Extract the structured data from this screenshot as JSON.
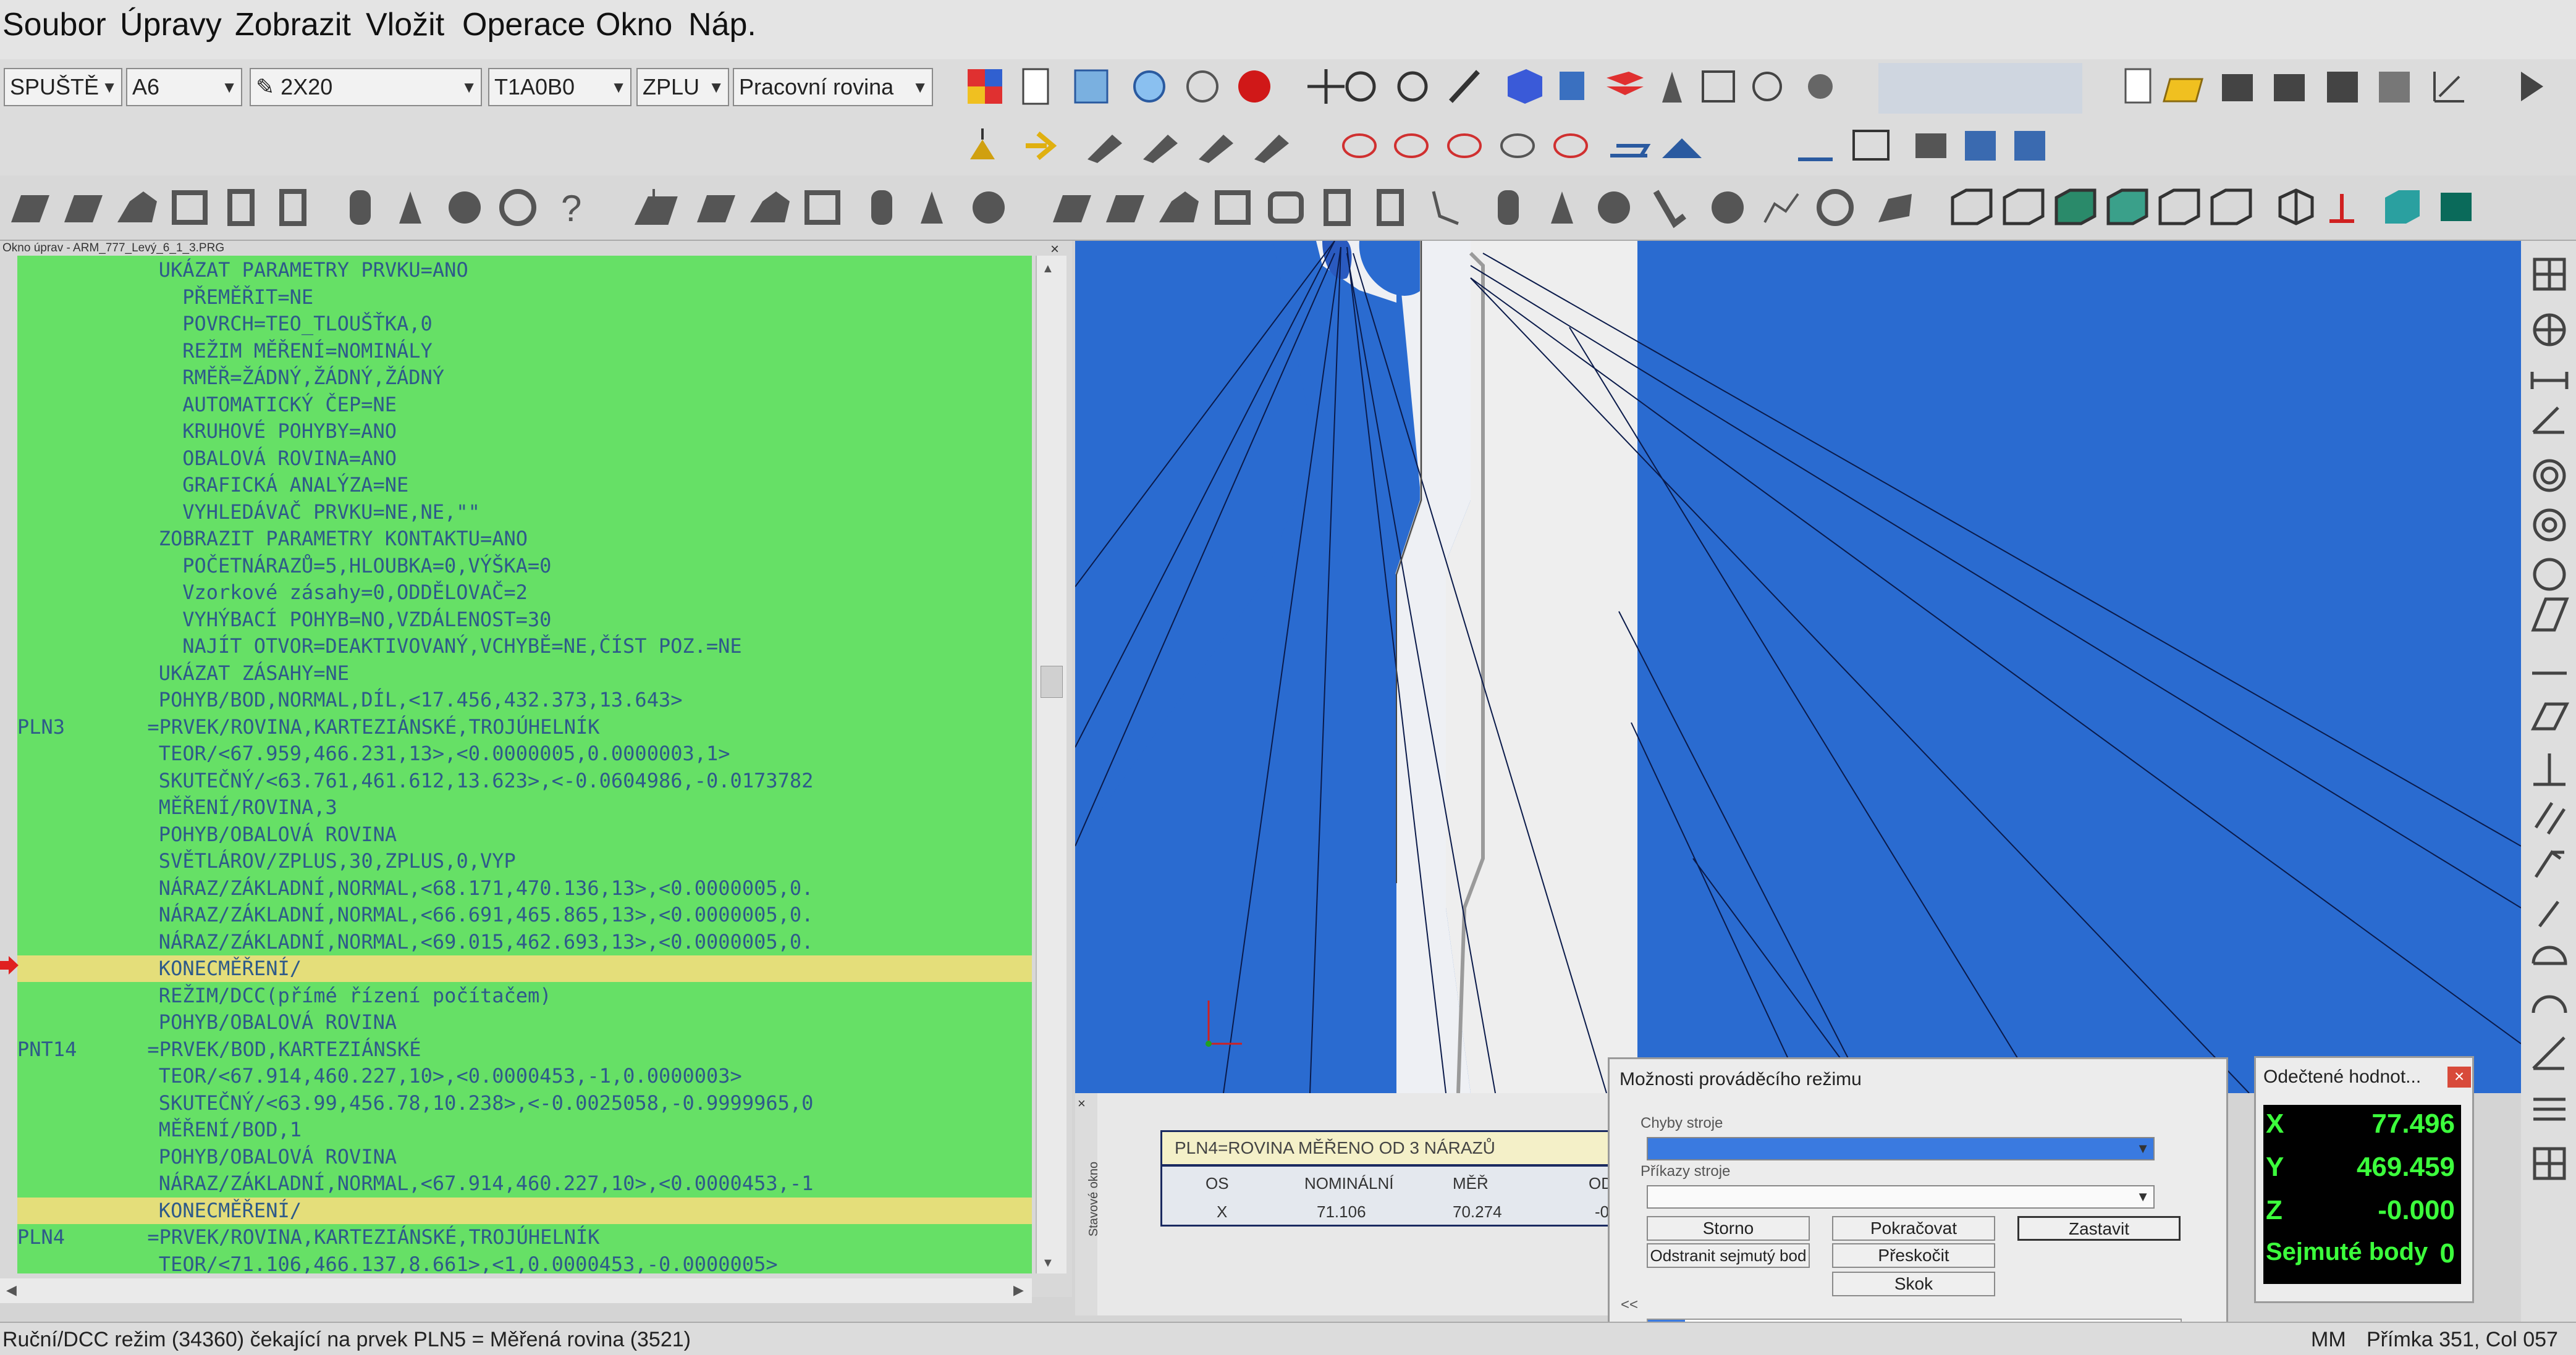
{
  "menu": [
    "Soubor",
    "Úpravy",
    "Zobrazit",
    "Vložit",
    "Operace",
    "Okno",
    "Náp."
  ],
  "toolbar": {
    "combo1": "SPUŠTĚ",
    "combo2": "A6",
    "combo3": "2X20",
    "combo4": "T1A0B0",
    "combo5": "ZPLU",
    "combo6": "Pracovní rovina"
  },
  "editor": {
    "title": "Okno úprav - ARM_777_Levý_6_1_3.PRG",
    "lines": [
      {
        "label": "",
        "text": "UKÁZAT PARAMETRY PRVKU=ANO",
        "indent": 7,
        "hl": false
      },
      {
        "label": "",
        "text": "PŘEMĚŘIT=NE",
        "indent": 8,
        "hl": false
      },
      {
        "label": "",
        "text": "POVRCH=TEO_TLOUŠŤKA,0",
        "indent": 8,
        "hl": false
      },
      {
        "label": "",
        "text": "REŽIM MĚŘENÍ=NOMINÁLY",
        "indent": 8,
        "hl": false
      },
      {
        "label": "",
        "text": "RMĚŘ=ŽÁDNÝ,ŽÁDNÝ,ŽÁDNÝ",
        "indent": 8,
        "hl": false
      },
      {
        "label": "",
        "text": "AUTOMATICKÝ ČEP=NE",
        "indent": 8,
        "hl": false
      },
      {
        "label": "",
        "text": "KRUHOVÉ POHYBY=ANO",
        "indent": 8,
        "hl": false
      },
      {
        "label": "",
        "text": "OBALOVÁ ROVINA=ANO",
        "indent": 8,
        "hl": false
      },
      {
        "label": "",
        "text": "GRAFICKÁ ANALÝZA=NE",
        "indent": 8,
        "hl": false
      },
      {
        "label": "",
        "text": "VYHLEDÁVAČ PRVKU=NE,NE,\"\"",
        "indent": 8,
        "hl": false
      },
      {
        "label": "",
        "text": "ZOBRAZIT PARAMETRY KONTAKTU=ANO",
        "indent": 7,
        "hl": false
      },
      {
        "label": "",
        "text": "POČETNÁRAZŮ=5,HLOUBKA=0,VÝŠKA=0",
        "indent": 8,
        "hl": false
      },
      {
        "label": "",
        "text": "Vzorkové zásahy=0,ODDĚLOVAČ=2",
        "indent": 8,
        "hl": false
      },
      {
        "label": "",
        "text": "VYHÝBACÍ POHYB=NO,VZDÁLENOST=30",
        "indent": 8,
        "hl": false
      },
      {
        "label": "",
        "text": "NAJÍT OTVOR=DEAKTIVOVANÝ,VCHYBĚ=NE,ČÍST POZ.=NE",
        "indent": 8,
        "hl": false
      },
      {
        "label": "",
        "text": "UKÁZAT ZÁSAHY=NE",
        "indent": 7,
        "hl": false
      },
      {
        "label": "",
        "text": "POHYB/BOD,NORMAL,DÍL,<17.456,432.373,13.643>",
        "indent": 7,
        "hl": false
      },
      {
        "label": "PLN3",
        "text": "=PRVEK/ROVINA,KARTEZIÁNSKÉ,TROJÚHELNÍK",
        "indent": 6,
        "hl": false
      },
      {
        "label": "",
        "text": "TEOR/<67.959,466.231,13>,<0.0000005,0.0000003,1>",
        "indent": 7,
        "hl": false
      },
      {
        "label": "",
        "text": "SKUTEČNÝ/<63.761,461.612,13.623>,<-0.0604986,-0.0173782",
        "indent": 7,
        "hl": false
      },
      {
        "label": "",
        "text": "MĚŘENÍ/ROVINA,3",
        "indent": 7,
        "hl": false
      },
      {
        "label": "",
        "text": "POHYB/OBALOVÁ ROVINA",
        "indent": 7,
        "hl": false
      },
      {
        "label": "",
        "text": "SVĚTLÁROV/ZPLUS,30,ZPLUS,0,VYP",
        "indent": 7,
        "hl": false
      },
      {
        "label": "",
        "text": "NÁRAZ/ZÁKLADNÍ,NORMAL,<68.171,470.136,13>,<0.0000005,0.",
        "indent": 7,
        "hl": false
      },
      {
        "label": "",
        "text": "NÁRAZ/ZÁKLADNÍ,NORMAL,<66.691,465.865,13>,<0.0000005,0.",
        "indent": 7,
        "hl": false
      },
      {
        "label": "",
        "text": "NÁRAZ/ZÁKLADNÍ,NORMAL,<69.015,462.693,13>,<0.0000005,0.",
        "indent": 7,
        "hl": false
      },
      {
        "label": "",
        "text": "KONECMĚŘENÍ/",
        "indent": 7,
        "hl": true
      },
      {
        "label": "",
        "text": "REŽIM/DCC(přímé řízení počítačem)",
        "indent": 7,
        "hl": false
      },
      {
        "label": "",
        "text": "POHYB/OBALOVÁ ROVINA",
        "indent": 7,
        "hl": false
      },
      {
        "label": "PNT14",
        "text": "=PRVEK/BOD,KARTEZIÁNSKÉ",
        "indent": 6,
        "hl": false
      },
      {
        "label": "",
        "text": "TEOR/<67.914,460.227,10>,<0.0000453,-1,0.0000003>",
        "indent": 7,
        "hl": false
      },
      {
        "label": "",
        "text": "SKUTEČNÝ/<63.99,456.78,10.238>,<-0.0025058,-0.9999965,0",
        "indent": 7,
        "hl": false
      },
      {
        "label": "",
        "text": "MĚŘENÍ/BOD,1",
        "indent": 7,
        "hl": false
      },
      {
        "label": "",
        "text": "POHYB/OBALOVÁ ROVINA",
        "indent": 7,
        "hl": false
      },
      {
        "label": "",
        "text": "NÁRAZ/ZÁKLADNÍ,NORMAL,<67.914,460.227,10>,<0.0000453,-1",
        "indent": 7,
        "hl": false
      },
      {
        "label": "",
        "text": "KONECMĚŘENÍ/",
        "indent": 7,
        "hl": true
      },
      {
        "label": "PLN4",
        "text": "=PRVEK/ROVINA,KARTEZIÁNSKÉ,TROJÚHELNÍK",
        "indent": 6,
        "hl": false
      },
      {
        "label": "",
        "text": "TEOR/<71.106,466.137,8.661>,<1,0.0000453,-0.0000005>",
        "indent": 7,
        "hl": false
      }
    ]
  },
  "dock": {
    "side_label": "Stavové okno",
    "title": "PLN4=ROVINA MĚŘENO OD 3 NÁRAZŮ",
    "headers": [
      "OS",
      "NOMINÁLNÍ",
      "MĚŘ",
      "ODC"
    ],
    "row": [
      "X",
      "71.106",
      "70.274",
      "-0.8"
    ]
  },
  "exec_dialog": {
    "title": "Možnosti prováděcího režimu",
    "errors_label": "Chyby stroje",
    "commands_label": "Příkazy stroje",
    "btn_cancel": "Storno",
    "btn_continue": "Pokračovat",
    "btn_stop": "Zastavit",
    "btn_remove": "Odstranit sejmutý bod",
    "btn_skip": "Přeskočit",
    "btn_jump": "Skok",
    "collapse": "<<",
    "progress": "7%"
  },
  "readout": {
    "title": "Odečtené hodnot...",
    "x_label": "X",
    "x": "77.496",
    "y_label": "Y",
    "y": "469.459",
    "z_label": "Z",
    "z": "-0.000",
    "pts_label": "Sejmuté body",
    "pts": "0"
  },
  "status": {
    "left": "Ruční/DCC režim (34360) čekající na prvek PLN5 = Měřená rovina (3521)",
    "units": "MM",
    "pos": "Přímka 351, Col 057"
  },
  "colors": {
    "code_bg": "#66e066",
    "code_text": "#2e5a8a",
    "view_bg": "#2a6bd0",
    "readout_green": "#3cff3c"
  }
}
